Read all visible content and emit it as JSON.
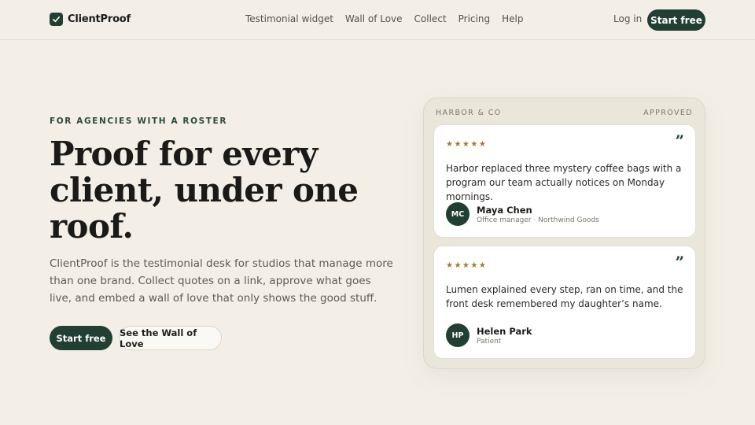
{
  "brand": {
    "name": "ClientProof",
    "icon": "check-icon",
    "accent": "#213f33"
  },
  "nav": {
    "links": [
      "Testimonial widget",
      "Wall of Love",
      "Collect",
      "Pricing",
      "Help"
    ],
    "login": "Log in",
    "cta": "Start free"
  },
  "hero": {
    "eyebrow": "FOR AGENCIES WITH A ROSTER",
    "headline_lines": [
      "Proof for every",
      "client, under one",
      "roof."
    ],
    "subheadline": "ClientProof is the testimonial desk for studios that manage more than one brand. Collect quotes on a link, approve what goes live, and embed a wall of love that only shows the good stuff.",
    "primary_cta": "Start free",
    "secondary_cta": "See the Wall of Love"
  },
  "panel": {
    "client": "HARBOR & CO",
    "status": "APPROVED",
    "testimonials": [
      {
        "rating": 5,
        "stars": "★★★★★",
        "quote": "Harbor replaced three mystery coffee bags with a program our team actually notices on Monday mornings.",
        "initials": "MC",
        "name": "Maya Chen",
        "role": "Office manager · Northwind Goods"
      },
      {
        "rating": 5,
        "stars": "★★★★★",
        "quote": "Lumen explained every step, ran on time, and the front desk remembered my daughter’s name.",
        "initials": "HP",
        "name": "Helen Park",
        "role": "Patient"
      }
    ],
    "quote_mark": "”",
    "star_color": "#a07a2d"
  },
  "colors": {
    "background": "#f3efe7",
    "accent": "#213f33"
  }
}
